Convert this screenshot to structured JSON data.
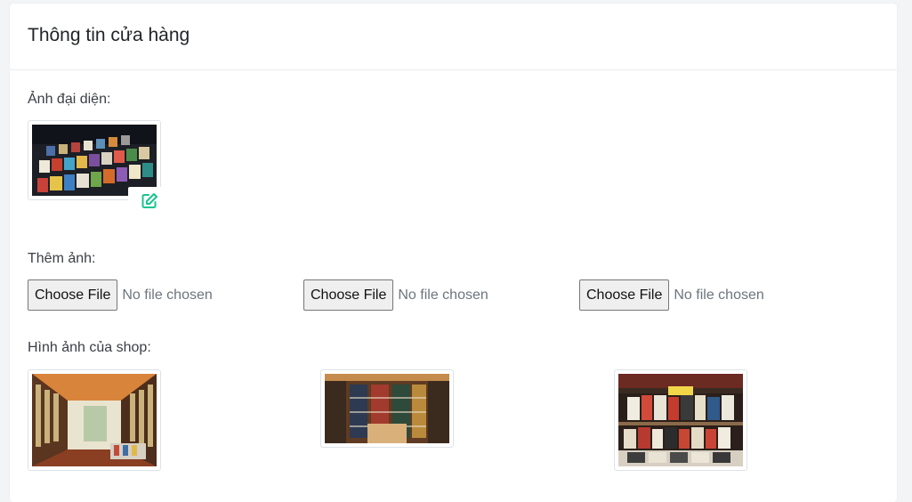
{
  "card": {
    "title": "Thông tin cửa hàng"
  },
  "avatar": {
    "label": "Ảnh đại diện:",
    "edit_icon": "edit-icon",
    "accent_color": "#17c48e"
  },
  "add_photos": {
    "label": "Thêm ảnh:",
    "inputs": [
      {
        "button_label": "Choose File",
        "status": "No file chosen"
      },
      {
        "button_label": "Choose File",
        "status": "No file chosen"
      },
      {
        "button_label": "Choose File",
        "status": "No file chosen"
      }
    ]
  },
  "shop_photos": {
    "label": "Hình ảnh của shop:"
  }
}
